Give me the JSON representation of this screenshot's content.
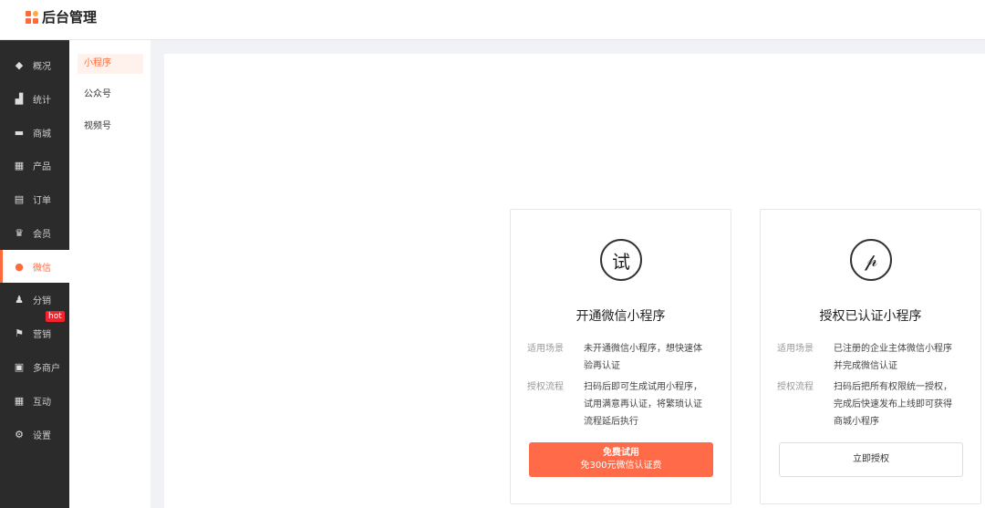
{
  "app": {
    "title": "后台管理"
  },
  "sidebar": {
    "items": [
      {
        "label": "概况",
        "icon": "layers-icon",
        "glyph": "◆"
      },
      {
        "label": "统计",
        "icon": "chart-icon",
        "glyph": "▟"
      },
      {
        "label": "商城",
        "icon": "store-icon",
        "glyph": "▬"
      },
      {
        "label": "产品",
        "icon": "grid-icon",
        "glyph": "▦"
      },
      {
        "label": "订单",
        "icon": "clipboard-icon",
        "glyph": "▤"
      },
      {
        "label": "会员",
        "icon": "crown-icon",
        "glyph": "♛"
      },
      {
        "label": "微信",
        "icon": "wechat-icon",
        "glyph": "●"
      },
      {
        "label": "分销",
        "icon": "users-icon",
        "glyph": "♟"
      },
      {
        "label": "营销",
        "icon": "flag-icon",
        "glyph": "⚑",
        "badge": "hot"
      },
      {
        "label": "多商户",
        "icon": "merchant-icon",
        "glyph": "▣"
      },
      {
        "label": "互动",
        "icon": "apps-icon",
        "glyph": "▦"
      },
      {
        "label": "设置",
        "icon": "gear-icon",
        "glyph": "⚙"
      }
    ]
  },
  "subnav": {
    "items": [
      "小程序",
      "公众号",
      "视频号"
    ]
  },
  "cards": [
    {
      "icon_glyph": "试",
      "title": "开通微信小程序",
      "scene_label": "适用场景",
      "scene_lines": [
        "未开通微信小程序，想快速体",
        "验再认证"
      ],
      "flow_label": "授权流程",
      "flow_lines": [
        "扫码后即可生成试用小程序，",
        "试用满意再认证，将繁琐认证",
        "流程延后执行"
      ],
      "button_line1": "免费试用",
      "button_line2": "免300元微信认证费"
    },
    {
      "icon_glyph": "𝓅",
      "title": "授权已认证小程序",
      "scene_label": "适用场景",
      "scene_lines": [
        "已注册的企业主体微信小程序",
        "并完成微信认证"
      ],
      "flow_label": "授权流程",
      "flow_lines": [
        "扫码后把所有权限统一授权，",
        "完成后快速发布上线即可获得",
        "商城小程序"
      ],
      "button_label": "立即授权"
    }
  ],
  "colors": {
    "accent": "#ff6a3d",
    "sidebar_bg": "#2b2b2b"
  }
}
